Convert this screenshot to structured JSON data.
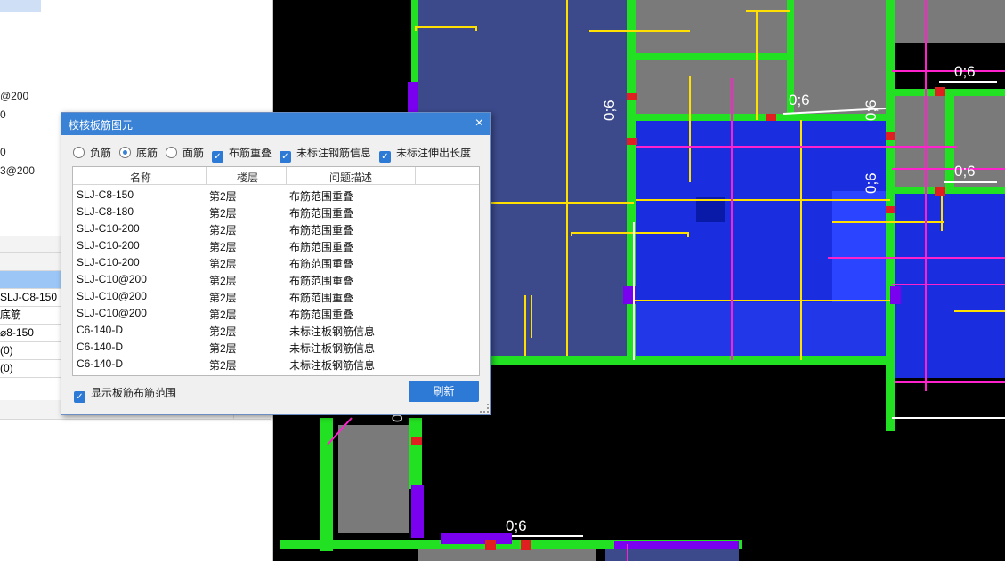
{
  "left_panel": {
    "fragments": [
      "@200",
      "0",
      "0",
      "3@200"
    ],
    "prop_rows": [
      "SLJ-C8-150",
      "底筋",
      "⌀8-150",
      "(0)",
      "(0)"
    ]
  },
  "dialog": {
    "title": "校核板筋图元",
    "close_glyph": "×",
    "options": {
      "radio_neg": "负筋",
      "radio_bottom": "底筋",
      "radio_top": "面筋",
      "chk_overlap": "布筋重叠",
      "chk_unlabeled": "未标注钢筋信息",
      "chk_extend": "未标注伸出长度"
    },
    "columns": [
      "名称",
      "楼层",
      "问题描述"
    ],
    "rows": [
      {
        "name": "SLJ-C8-150",
        "floor": "第2层",
        "desc": "布筋范围重叠"
      },
      {
        "name": "SLJ-C8-180",
        "floor": "第2层",
        "desc": "布筋范围重叠"
      },
      {
        "name": "SLJ-C10-200",
        "floor": "第2层",
        "desc": "布筋范围重叠"
      },
      {
        "name": "SLJ-C10-200",
        "floor": "第2层",
        "desc": "布筋范围重叠"
      },
      {
        "name": "SLJ-C10-200",
        "floor": "第2层",
        "desc": "布筋范围重叠"
      },
      {
        "name": "SLJ-C10@200",
        "floor": "第2层",
        "desc": "布筋范围重叠"
      },
      {
        "name": "SLJ-C10@200",
        "floor": "第2层",
        "desc": "布筋范围重叠"
      },
      {
        "name": "SLJ-C10@200",
        "floor": "第2层",
        "desc": "布筋范围重叠"
      },
      {
        "name": "C6-140-D",
        "floor": "第2层",
        "desc": "未标注板钢筋信息"
      },
      {
        "name": "C6-140-D",
        "floor": "第2层",
        "desc": "未标注板钢筋信息"
      },
      {
        "name": "C6-140-D",
        "floor": "第2层",
        "desc": "未标注板钢筋信息"
      }
    ],
    "show_range_label": "显示板筋布筋范围",
    "refresh_label": "刷新"
  },
  "canvas": {
    "labels": [
      "0;6",
      "0;6",
      "0;6",
      "0;6",
      "0;6",
      "0;6",
      "0;6",
      "0;6"
    ]
  },
  "colors": {
    "accent": "#2d7ad6",
    "slab_dark": "#3c4a8c",
    "slab_blue": "#1a2ee0",
    "wall_green": "#22e022",
    "beam_purple": "#7a00f0",
    "rebar_yellow": "#ffe000",
    "rebar_magenta": "#ff22cc",
    "gray": "#7a7a7a"
  }
}
